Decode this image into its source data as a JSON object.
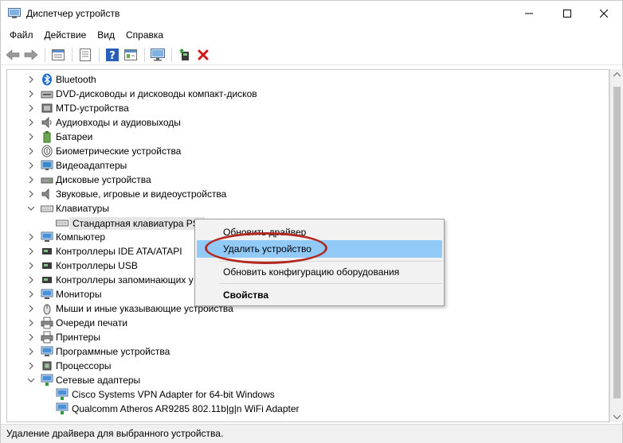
{
  "window": {
    "title": "Диспетчер устройств"
  },
  "menu": [
    {
      "label": "Файл"
    },
    {
      "label": "Действие"
    },
    {
      "label": "Вид"
    },
    {
      "label": "Справка"
    }
  ],
  "toolbar": {
    "buttons": [
      "back-icon",
      "forward-icon",
      "properties-icon",
      "list-icon",
      "help-icon",
      "update-icon",
      "monitor-icon",
      "add-driver-icon",
      "remove-icon"
    ]
  },
  "tree": {
    "items": [
      {
        "label": "Bluetooth",
        "icon": "bluetooth-icon",
        "level": 0,
        "expanded": false
      },
      {
        "label": "DVD-дисководы и дисководы компакт-дисков",
        "icon": "dvd-icon",
        "level": 0,
        "expanded": false
      },
      {
        "label": "MTD-устройства",
        "icon": "mtd-icon",
        "level": 0,
        "expanded": false
      },
      {
        "label": "Аудиовходы и аудиовыходы",
        "icon": "audio-icon",
        "level": 0,
        "expanded": false
      },
      {
        "label": "Батареи",
        "icon": "battery-icon",
        "level": 0,
        "expanded": false
      },
      {
        "label": "Биометрические устройства",
        "icon": "fingerprint-icon",
        "level": 0,
        "expanded": false
      },
      {
        "label": "Видеоадаптеры",
        "icon": "display-adapter-icon",
        "level": 0,
        "expanded": false
      },
      {
        "label": "Дисковые устройства",
        "icon": "disk-icon",
        "level": 0,
        "expanded": false
      },
      {
        "label": "Звуковые, игровые и видеоустройства",
        "icon": "sound-icon",
        "level": 0,
        "expanded": false
      },
      {
        "label": "Клавиатуры",
        "icon": "keyboard-icon",
        "level": 0,
        "expanded": true
      },
      {
        "label": "Стандартная клавиатура PS/",
        "icon": "keyboard-icon",
        "level": 1,
        "selected": true
      },
      {
        "label": "Компьютер",
        "icon": "computer-icon",
        "level": 0,
        "expanded": false
      },
      {
        "label": "Контроллеры IDE ATA/ATAPI",
        "icon": "ide-icon",
        "level": 0,
        "expanded": false
      },
      {
        "label": "Контроллеры USB",
        "icon": "usb-icon",
        "level": 0,
        "expanded": false
      },
      {
        "label": "Контроллеры запоминающих у",
        "icon": "storage-icon",
        "level": 0,
        "expanded": false
      },
      {
        "label": "Мониторы",
        "icon": "monitor-icon",
        "level": 0,
        "expanded": false
      },
      {
        "label": "Мыши и иные указывающие устройства",
        "icon": "mouse-icon",
        "level": 0,
        "expanded": false
      },
      {
        "label": "Очереди печати",
        "icon": "print-queue-icon",
        "level": 0,
        "expanded": false
      },
      {
        "label": "Принтеры",
        "icon": "printer-icon",
        "level": 0,
        "expanded": false
      },
      {
        "label": "Программные устройства",
        "icon": "software-device-icon",
        "level": 0,
        "expanded": false
      },
      {
        "label": "Процессоры",
        "icon": "processor-icon",
        "level": 0,
        "expanded": false
      },
      {
        "label": "Сетевые адаптеры",
        "icon": "network-icon",
        "level": 0,
        "expanded": true
      },
      {
        "label": "Cisco Systems VPN Adapter for 64-bit Windows",
        "icon": "network-adapter-icon",
        "level": 1
      },
      {
        "label": "Qualcomm Atheros AR9285 802.11b|g|n WiFi Adapter",
        "icon": "network-adapter-icon",
        "level": 1
      }
    ]
  },
  "context_menu": {
    "items": [
      {
        "label": "Обновить драйвер"
      },
      {
        "label": "Удалить устройство",
        "highlighted": true
      },
      {
        "label": "Обновить конфигурацию оборудования"
      },
      {
        "label": "Свойства",
        "bold": true
      }
    ]
  },
  "status": {
    "text": "Удаление драйвера для выбранного устройства."
  },
  "colors": {
    "highlight": "#91c9f7",
    "annotation": "#b42822",
    "remove": "#d0191d",
    "bluetooth": "#1d6fd6"
  }
}
